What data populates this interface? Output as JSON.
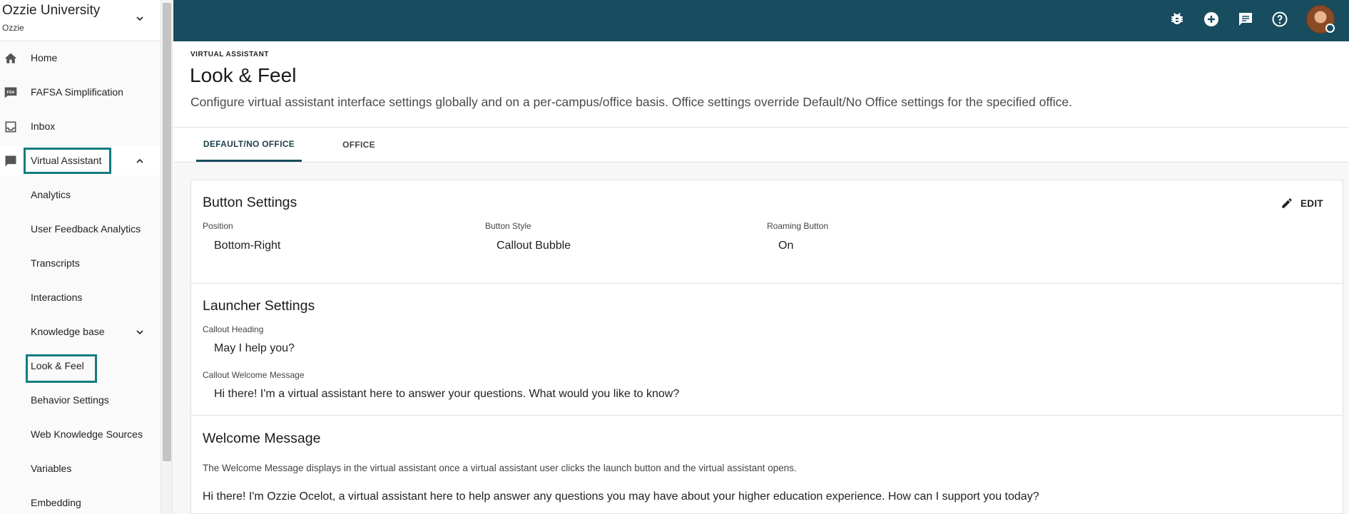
{
  "org": {
    "name": "Ozzie University",
    "sub": "Ozzie"
  },
  "nav": {
    "home": "Home",
    "fafsa": "FAFSA Simplification",
    "inbox": "Inbox",
    "virtual_assistant": "Virtual Assistant",
    "sub": {
      "analytics": "Analytics",
      "user_feedback": "User Feedback Analytics",
      "transcripts": "Transcripts",
      "interactions": "Interactions",
      "knowledge_base": "Knowledge base",
      "look_feel": "Look & Feel",
      "behavior": "Behavior Settings",
      "web_sources": "Web Knowledge Sources",
      "variables": "Variables",
      "embedding": "Embedding"
    }
  },
  "header": {
    "crumb": "VIRTUAL ASSISTANT",
    "title": "Look & Feel",
    "description": "Configure virtual assistant interface settings globally and on a per-campus/office basis. Office settings override Default/No Office settings for the specified office."
  },
  "tabs": {
    "default": "DEFAULT/NO OFFICE",
    "office": "OFFICE"
  },
  "button_settings": {
    "title": "Button Settings",
    "edit": "EDIT",
    "position_label": "Position",
    "position_value": "Bottom-Right",
    "style_label": "Button Style",
    "style_value": "Callout Bubble",
    "roaming_label": "Roaming Button",
    "roaming_value": "On"
  },
  "launcher_settings": {
    "title": "Launcher Settings",
    "heading_label": "Callout Heading",
    "heading_value": "May I help you?",
    "welcome_label": "Callout Welcome Message",
    "welcome_value": "Hi there! I'm a virtual assistant here to answer your questions. What would you like to know?"
  },
  "welcome_message": {
    "title": "Welcome Message",
    "description": "The Welcome Message displays in the virtual assistant once a virtual assistant user clicks the launch button and the virtual assistant opens.",
    "text": "Hi there! I'm Ozzie Ocelot, a virtual assistant here to help answer any questions you may have about your higher education experience. How can I support you today?"
  },
  "icons": {
    "top": [
      "bug-icon",
      "add-circle-icon",
      "chat-icon",
      "help-icon"
    ]
  },
  "colors": {
    "topbar": "#174d5e",
    "highlight": "#137c80"
  }
}
